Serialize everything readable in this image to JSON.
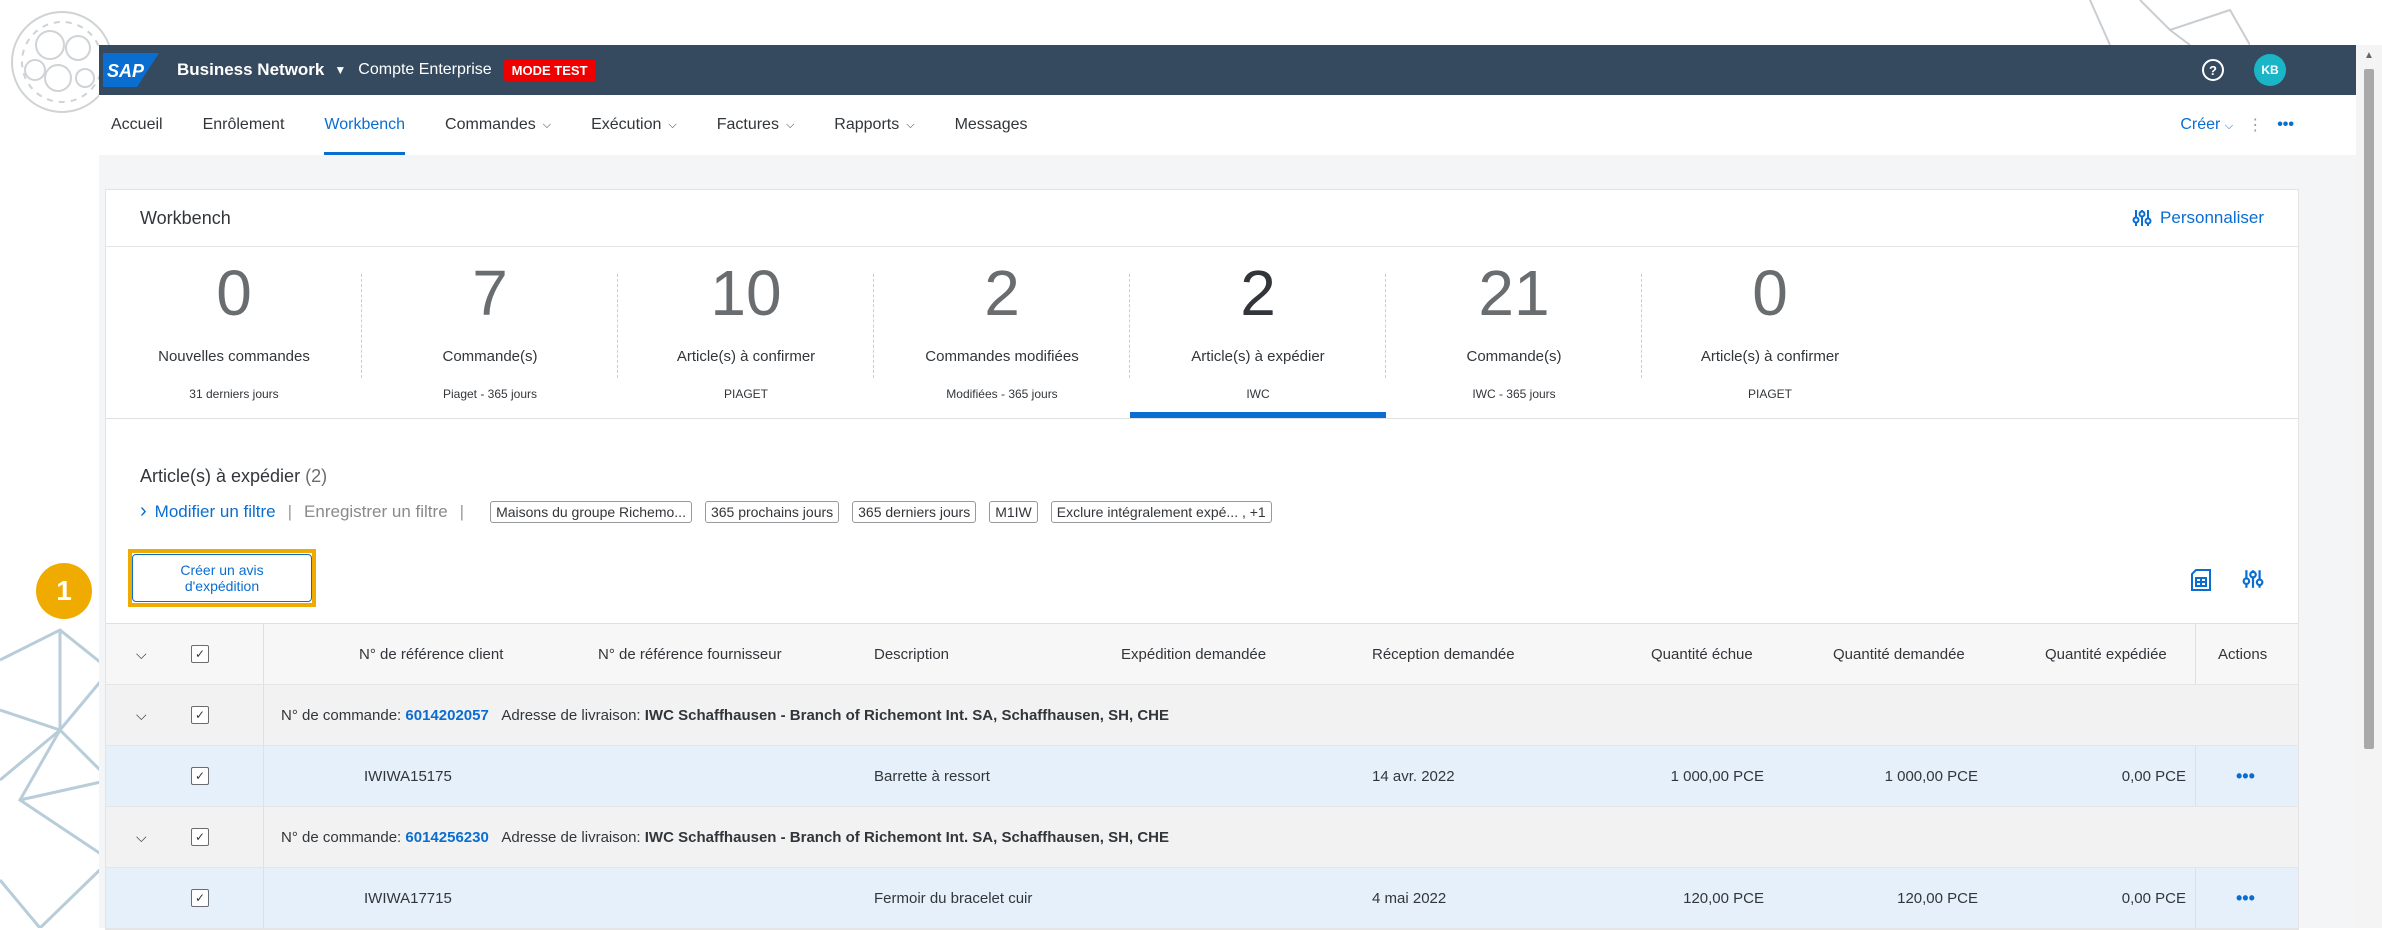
{
  "shell": {
    "logo": "SAP",
    "product": "Business Network",
    "account": "Compte Enterprise",
    "mode_badge": "MODE TEST",
    "avatar": "KB",
    "help": "?"
  },
  "nav": {
    "items": [
      {
        "label": "Accueil"
      },
      {
        "label": "Enrôlement"
      },
      {
        "label": "Workbench"
      },
      {
        "label": "Commandes"
      },
      {
        "label": "Exécution"
      },
      {
        "label": "Factures"
      },
      {
        "label": "Rapports"
      },
      {
        "label": "Messages"
      }
    ],
    "create_label": "Créer",
    "active_index": 2
  },
  "workbench": {
    "title": "Workbench",
    "personalize": "Personnaliser",
    "tiles": [
      {
        "num": "0",
        "label": "Nouvelles commandes",
        "sub": "31 derniers jours"
      },
      {
        "num": "7",
        "label": "Commande(s)",
        "sub": "Piaget - 365 jours"
      },
      {
        "num": "10",
        "label": "Article(s) à confirmer",
        "sub": "PIAGET"
      },
      {
        "num": "2",
        "label": "Commandes modifiées",
        "sub": "Modifiées - 365 jours"
      },
      {
        "num": "2",
        "label": "Article(s) à expédier",
        "sub": "IWC"
      },
      {
        "num": "21",
        "label": "Commande(s)",
        "sub": "IWC - 365 jours"
      },
      {
        "num": "0",
        "label": "Article(s) à confirmer",
        "sub": "PIAGET"
      }
    ],
    "active_tile": 4
  },
  "section": {
    "title": "Article(s) à expédier",
    "count": "(2)",
    "modify_filter": "Modifier un filtre",
    "save_filter": "Enregistrer un filtre",
    "chips": [
      "Maisons du groupe Richemo...",
      "365 prochains jours",
      "365 derniers jours",
      "M1IW",
      "Exclure intégralement expé... , +1"
    ],
    "create_button": "Créer un avis d'expédition",
    "step_number": "1"
  },
  "table": {
    "headers": {
      "client_ref": "N° de référence client",
      "supplier_ref": "N° de référence fournisseur",
      "description": "Description",
      "ship_req": "Expédition demandée",
      "recv_req": "Réception demandée",
      "qty_due": "Quantité échue",
      "qty_req": "Quantité demandée",
      "qty_shipped": "Quantité expédiée",
      "actions": "Actions"
    },
    "groups": [
      {
        "order_label": "N° de commande:",
        "order_no": "6014202057",
        "addr_label": "Adresse de livraison:",
        "addr": "IWC Schaffhausen - Branch of Richemont Int. SA, Schaffhausen, SH, CHE",
        "item": {
          "client_ref": "IWIWA15175",
          "description": "Barrette à ressort",
          "recv_req": "14 avr. 2022",
          "qty_due": "1 000,00 PCE",
          "qty_req": "1 000,00 PCE",
          "qty_shipped": "0,00 PCE",
          "actions": "•••"
        }
      },
      {
        "order_label": "N° de commande:",
        "order_no": "6014256230",
        "addr_label": "Adresse de livraison:",
        "addr": "IWC Schaffhausen - Branch of Richemont Int. SA, Schaffhausen, SH, CHE",
        "item": {
          "client_ref": "IWIWA17715",
          "description": "Fermoir du bracelet cuir",
          "recv_req": "4 mai 2022",
          "qty_due": "120,00 PCE",
          "qty_req": "120,00 PCE",
          "qty_shipped": "0,00 PCE",
          "actions": "•••"
        }
      }
    ]
  },
  "colors": {
    "shell": "#354a5f",
    "accent": "#0a6ed1",
    "highlight": "#f0ab00",
    "badge": "#e00000"
  }
}
